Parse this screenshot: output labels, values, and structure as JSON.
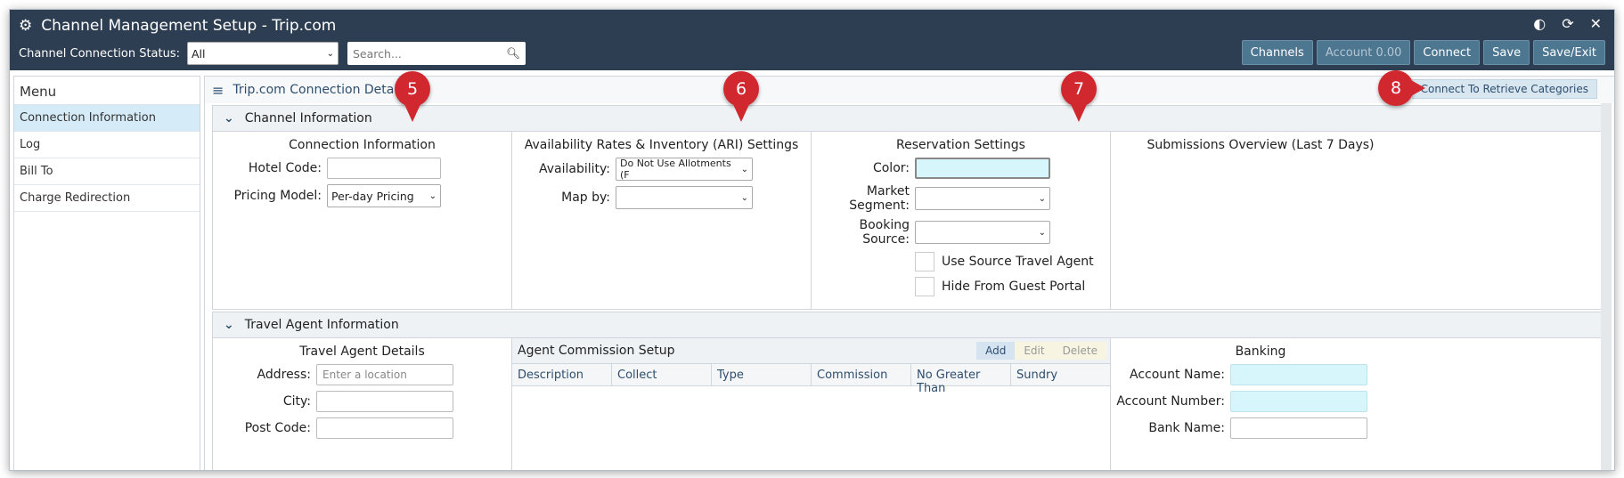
{
  "window": {
    "title": "Channel Management Setup - Trip.com",
    "status_label": "Channel Connection Status:",
    "status_value": "All",
    "search_placeholder": "Search...",
    "buttons": [
      "Channels",
      "Account 0.00",
      "Connect",
      "Save",
      "Save/Exit"
    ]
  },
  "sidebar": {
    "header": "Menu",
    "items": [
      "Connection Information",
      "Log",
      "Bill To",
      "Charge Redirection"
    ]
  },
  "main": {
    "header": "Trip.com Connection Details",
    "retrieve_button": "Connect To Retrieve Categories",
    "channel_info": {
      "title": "Channel Information",
      "connection": {
        "title": "Connection Information",
        "hotel_code_label": "Hotel Code:",
        "hotel_code_value": "",
        "pricing_model_label": "Pricing Model:",
        "pricing_model_value": "Per-day Pricing"
      },
      "ari": {
        "title": "Availability Rates & Inventory (ARI) Settings",
        "availability_label": "Availability:",
        "availability_value": "Do Not Use Allotments (F",
        "map_by_label": "Map by:",
        "map_by_value": ""
      },
      "reservation": {
        "title": "Reservation Settings",
        "color_label": "Color:",
        "market_segment_label": "Market Segment:",
        "booking_source_label": "Booking Source:",
        "use_source_label": "Use Source Travel Agent",
        "hide_portal_label": "Hide From Guest Portal"
      },
      "submissions": {
        "title": "Submissions Overview (Last 7 Days)"
      }
    },
    "travel_agent": {
      "title": "Travel Agent Information",
      "details": {
        "title": "Travel Agent Details",
        "address_label": "Address:",
        "address_placeholder": "Enter a location",
        "city_label": "City:",
        "post_code_label": "Post Code:"
      },
      "commission": {
        "title": "Agent Commission Setup",
        "buttons": [
          "Add",
          "Edit",
          "Delete"
        ],
        "columns": [
          "Description",
          "Collect",
          "Type",
          "Commission",
          "No Greater Than",
          "Sundry"
        ]
      },
      "banking": {
        "title": "Banking",
        "account_name_label": "Account Name:",
        "account_number_label": "Account Number:",
        "bank_name_label": "Bank Name:"
      }
    }
  },
  "callouts": [
    "5",
    "6",
    "7",
    "8"
  ],
  "colors": {
    "titlebar": "#2e3e52",
    "callout": "#d0282e",
    "accent_input": "#d6f6fb"
  }
}
